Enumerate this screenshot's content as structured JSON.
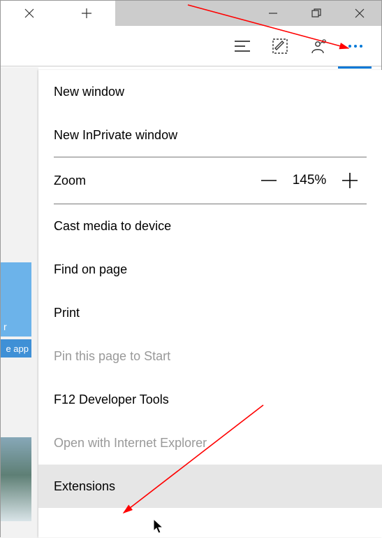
{
  "blue_tile_text1": "r",
  "blue_tile_text2": "e app",
  "zoom": {
    "label": "Zoom",
    "value": "145%"
  },
  "menu": {
    "new_window": "New window",
    "new_inprivate": "New InPrivate window",
    "cast": "Cast media to device",
    "find": "Find on page",
    "print": "Print",
    "pin": "Pin this page to Start",
    "devtools": "F12 Developer Tools",
    "open_ie": "Open with Internet Explorer",
    "extensions": "Extensions"
  }
}
